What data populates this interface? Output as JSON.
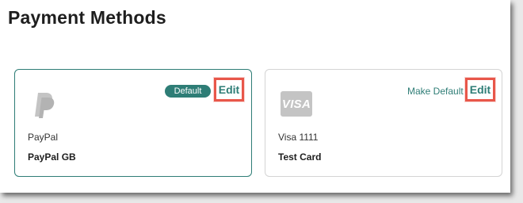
{
  "page": {
    "title": "Payment Methods"
  },
  "colors": {
    "accent": "#2e7d76",
    "highlight": "#e8574a",
    "logo_gray": "#c4c4c4"
  },
  "cards": [
    {
      "id": "paypal",
      "logo_icon": "paypal-icon",
      "selected": true,
      "badge": "Default",
      "edit_label": "Edit",
      "type": "PayPal",
      "name": "PayPal GB"
    },
    {
      "id": "visa",
      "logo_icon": "visa-icon",
      "logo_text": "VISA",
      "selected": false,
      "make_default_label": "Make Default",
      "edit_label": "Edit",
      "type": "Visa 1111",
      "name": "Test Card"
    }
  ]
}
